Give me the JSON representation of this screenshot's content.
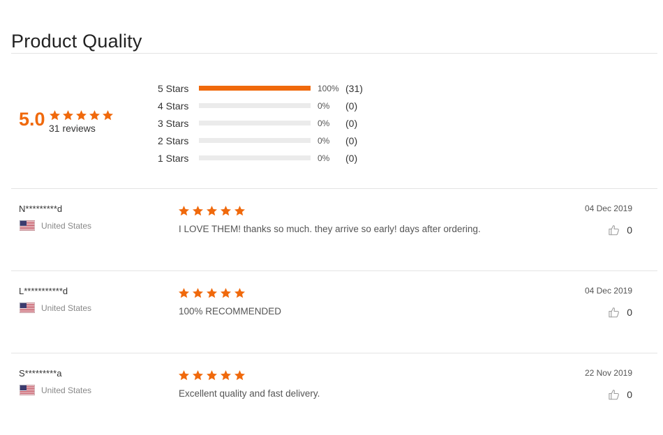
{
  "page": {
    "title": "Product Quality"
  },
  "colors": {
    "accent": "#f0690c",
    "track": "#ebebeb",
    "divider": "#e4e4e4"
  },
  "summary": {
    "average": "5.0",
    "star_rating": 5,
    "review_count_label": "31 reviews",
    "distribution": [
      {
        "label": "5 Stars",
        "percent_label": "100%",
        "count_label": "(31)",
        "fraction": 1.0
      },
      {
        "label": "4 Stars",
        "percent_label": "0%",
        "count_label": "(0)",
        "fraction": 0
      },
      {
        "label": "3 Stars",
        "percent_label": "0%",
        "count_label": "(0)",
        "fraction": 0
      },
      {
        "label": "2 Stars",
        "percent_label": "0%",
        "count_label": "(0)",
        "fraction": 0
      },
      {
        "label": "1 Stars",
        "percent_label": "0%",
        "count_label": "(0)",
        "fraction": 0
      }
    ]
  },
  "reviews": [
    {
      "name": "N*********d",
      "country": "United States",
      "flag_icon": "us-flag-icon",
      "rating": 5,
      "text": "I LOVE THEM! thanks so much. they arrive so early! days after ordering.",
      "date": "04 Dec 2019",
      "helpful_count": "0"
    },
    {
      "name": "L***********d",
      "country": "United States",
      "flag_icon": "us-flag-icon",
      "rating": 5,
      "text": "100% RECOMMENDED",
      "date": "04 Dec 2019",
      "helpful_count": "0"
    },
    {
      "name": "S*********a",
      "country": "United States",
      "flag_icon": "us-flag-icon",
      "rating": 5,
      "text": "Excellent quality and fast delivery.",
      "date": "22 Nov 2019",
      "helpful_count": "0"
    }
  ]
}
